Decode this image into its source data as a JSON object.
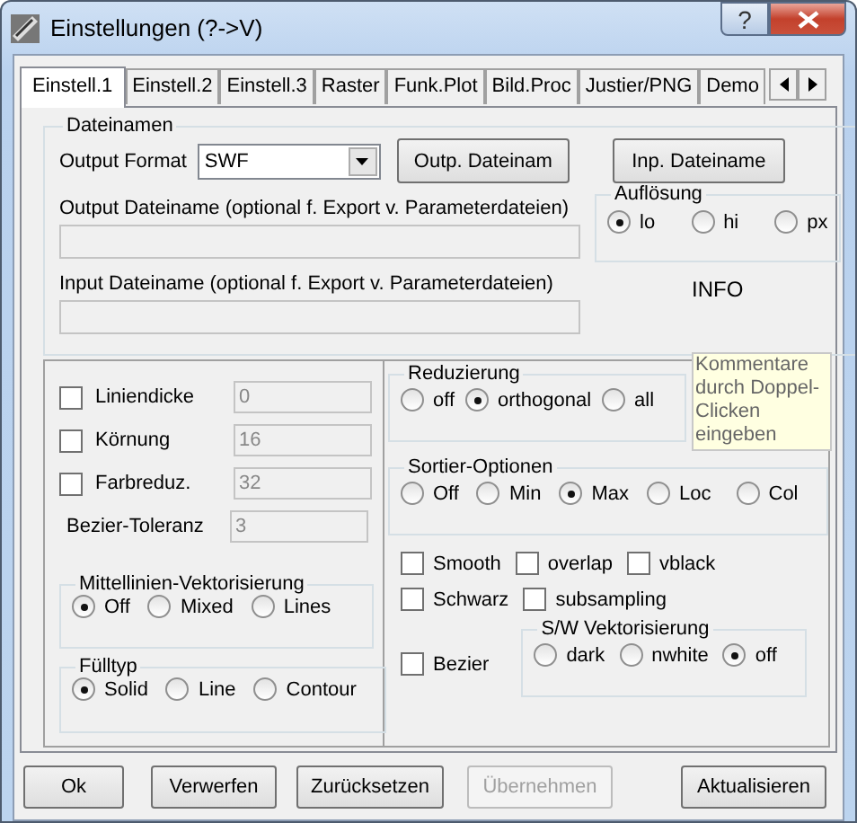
{
  "window": {
    "title": "Einstellungen (?->V)",
    "help_button": "?"
  },
  "tabs": [
    {
      "label": "Einstell.1",
      "selected": true
    },
    {
      "label": "Einstell.2",
      "selected": false
    },
    {
      "label": "Einstell.3",
      "selected": false
    },
    {
      "label": "Raster",
      "selected": false
    },
    {
      "label": "Funk.Plot",
      "selected": false
    },
    {
      "label": "Bild.Proc",
      "selected": false
    },
    {
      "label": "Justier/PNG",
      "selected": false
    },
    {
      "label": "Demo",
      "selected": false
    }
  ],
  "dateinamen": {
    "title": "Dateinamen",
    "format_label": "Output Format",
    "format_value": "SWF",
    "buttons": [
      "Outp. Dateinam",
      "Inp. Dateiname"
    ],
    "output_label": "Output Dateiname (optional f. Export v. Parameterdateien)",
    "input_label": "Input Dateiname (optional f. Export v. Parameterdateien)"
  },
  "aufloesung": {
    "title": "Auflösung",
    "options": [
      {
        "label": "lo",
        "selected": true
      },
      {
        "label": "hi",
        "selected": false
      },
      {
        "label": "px",
        "selected": false
      }
    ]
  },
  "info": "INFO",
  "fields": [
    {
      "kind": "checkbox",
      "label": "Liniendicke",
      "checked": false,
      "value": "0",
      "disabled": true
    },
    {
      "kind": "checkbox",
      "label": "Körnung",
      "checked": false,
      "value": "16",
      "disabled": true
    },
    {
      "kind": "checkbox",
      "label": "Farbreduz.",
      "checked": false,
      "value": "32",
      "disabled": true
    },
    {
      "kind": "plain",
      "label": "Bezier-Toleranz",
      "value": "3",
      "disabled": true
    }
  ],
  "mittellinien": {
    "title": "Mittellinien-Vektorisierung",
    "options": [
      {
        "label": "Off",
        "selected": true
      },
      {
        "label": "Mixed",
        "selected": false
      },
      {
        "label": "Lines",
        "selected": false
      }
    ]
  },
  "fuelltyp": {
    "title": "Fülltyp",
    "options": [
      {
        "label": "Solid",
        "selected": true
      },
      {
        "label": "Line",
        "selected": false
      },
      {
        "label": "Contour",
        "selected": false
      }
    ]
  },
  "reduzierung": {
    "title": "Reduzierung",
    "options": [
      {
        "label": "off",
        "selected": false
      },
      {
        "label": "orthogonal",
        "selected": true
      },
      {
        "label": "all",
        "selected": false
      }
    ]
  },
  "comment_note": "Kommentare durch Doppel-Clicken eingeben",
  "sortier": {
    "title": "Sortier-Optionen",
    "options": [
      {
        "label": "Off",
        "selected": false
      },
      {
        "label": "Min",
        "selected": false
      },
      {
        "label": "Max",
        "selected": true
      },
      {
        "label": "Loc",
        "selected": false
      },
      {
        "label": "Col",
        "selected": false
      }
    ]
  },
  "checkbox_rows": [
    {
      "items": [
        {
          "label": "Smooth",
          "checked": false
        },
        {
          "label": "overlap",
          "checked": false
        },
        {
          "label": "vblack",
          "checked": false
        }
      ]
    },
    {
      "items": [
        {
          "label": "Schwarz",
          "checked": false
        },
        {
          "label": "subsampling",
          "checked": false
        }
      ]
    }
  ],
  "bezier": {
    "label": "Bezier",
    "checked": false
  },
  "sw_vektorisierung": {
    "title": "S/W Vektorisierung",
    "options": [
      {
        "label": "dark",
        "selected": false
      },
      {
        "label": "nwhite",
        "selected": false
      },
      {
        "label": "off",
        "selected": true
      }
    ]
  },
  "buttons": [
    {
      "label": "Ok",
      "disabled": false
    },
    {
      "label": "Verwerfen",
      "disabled": false
    },
    {
      "label": "Zurücksetzen",
      "disabled": false
    },
    {
      "label": "Übernehmen",
      "disabled": true
    },
    {
      "label": "Aktualisieren",
      "disabled": false
    }
  ]
}
